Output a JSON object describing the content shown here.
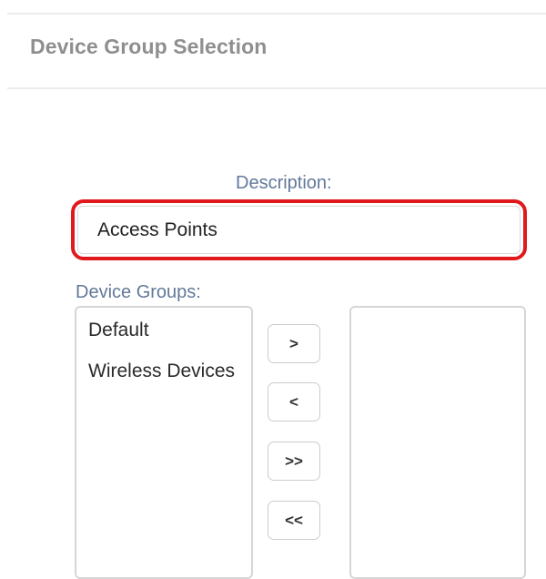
{
  "section": {
    "title": "Device Group Selection"
  },
  "description": {
    "label": "Description:",
    "value": "Access Points"
  },
  "device_groups": {
    "label": "Device Groups:",
    "available": [
      "Default",
      "Wireless Devices"
    ],
    "selected": []
  },
  "move_buttons": {
    "add": ">",
    "remove": "<",
    "add_all": ">>",
    "remove_all": "<<"
  },
  "colors": {
    "highlight_border": "#e0191c",
    "label_text": "#62789a",
    "title_text": "#8f8f8f"
  }
}
